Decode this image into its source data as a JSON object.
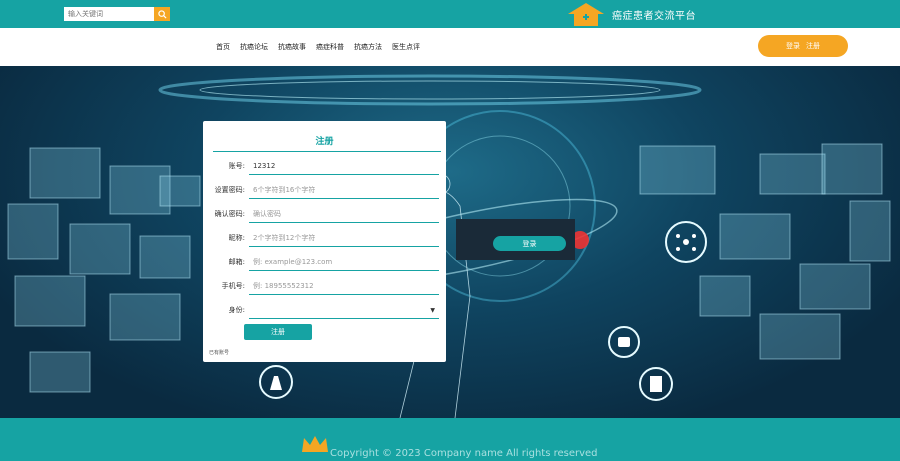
{
  "header": {
    "search_placeholder": "输入关键词",
    "brand_title": "癌症患者交流平台"
  },
  "nav": {
    "items": [
      "首页",
      "抗癌论坛",
      "抗癌故事",
      "癌症科普",
      "抗癌方法",
      "医生点评"
    ],
    "login": "登录",
    "register": "注册"
  },
  "form": {
    "title": "注册",
    "fields": [
      {
        "label": "账号:",
        "value": "12312",
        "placeholder": ""
      },
      {
        "label": "设置密码:",
        "value": "",
        "placeholder": "6个字符到16个字符"
      },
      {
        "label": "确认密码:",
        "value": "",
        "placeholder": "确认密码"
      },
      {
        "label": "昵称:",
        "value": "",
        "placeholder": "2个字符到12个字符"
      },
      {
        "label": "邮箱:",
        "value": "",
        "placeholder": "例: example@123.com"
      },
      {
        "label": "手机号:",
        "value": "",
        "placeholder": "例: 18955552312"
      },
      {
        "label": "身份:",
        "value": "",
        "placeholder": ""
      }
    ],
    "submit": "注册",
    "small_link": "已有账号"
  },
  "overlay": {
    "button": "登录"
  },
  "footer": {
    "copyright": "Copyright © 2023 Company name All rights reserved"
  },
  "colors": {
    "teal": "#16a3a3",
    "orange": "#f5a623"
  }
}
